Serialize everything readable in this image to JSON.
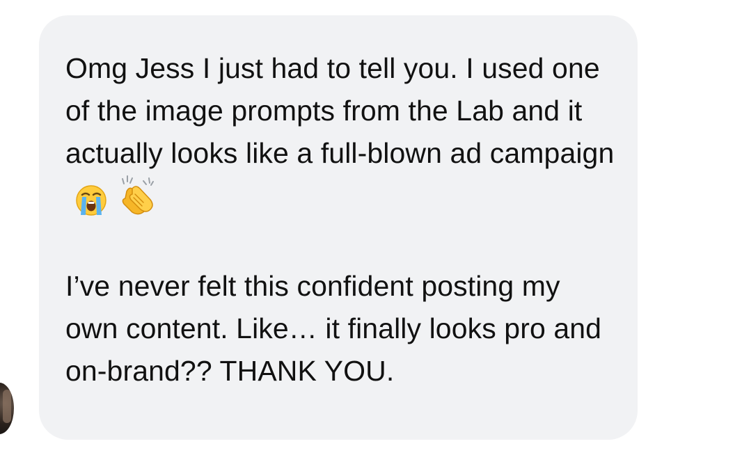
{
  "message": {
    "paragraph1": "Omg Jess I just had to tell you. I used one of the image prompts from the Lab and it actually looks like a full-blown ad campaign",
    "paragraph2": "I’ve never felt this confident posting my own content. Like… it finally looks pro and on-brand?? THANK YOU.",
    "emojis": [
      "loudly-crying-face-icon",
      "clapping-hands-icon"
    ]
  },
  "colors": {
    "bubble_bg": "#f1f2f4",
    "text": "#111111",
    "page_bg": "#ffffff"
  }
}
